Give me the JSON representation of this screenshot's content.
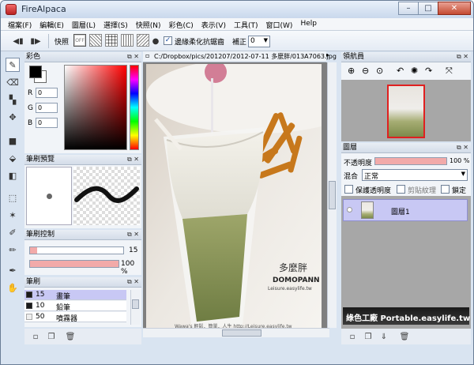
{
  "window": {
    "title": "FireAlpaca",
    "minimize_glyph": "–",
    "maximize_glyph": "□",
    "close_glyph": "✕"
  },
  "menu": [
    "檔案(F)",
    "編輯(E)",
    "圖層(L)",
    "選擇(S)",
    "快照(N)",
    "彩色(C)",
    "表示(V)",
    "工具(T)",
    "窗口(W)",
    "Help"
  ],
  "toolbar": {
    "snap_label": "快照",
    "snap_off_label": "OFF",
    "antialias_label": "邊緣柔化抗鋸齒",
    "antialias_checked": true,
    "correction_label": "補正",
    "correction_value": "0"
  },
  "color_panel": {
    "title": "彩色",
    "r_label": "R",
    "g_label": "G",
    "b_label": "B",
    "r_value": "0",
    "g_value": "0",
    "b_value": "0",
    "foreground": "#000000",
    "background": "#ffffff"
  },
  "brush_preview": {
    "title": "筆刷預覽"
  },
  "brush_control": {
    "title": "筆刷控制",
    "size_value": "15",
    "opacity_value": "100 %",
    "size_fraction": 0.08,
    "opacity_fraction": 1.0
  },
  "brush_list": {
    "title": "筆刷",
    "items": [
      {
        "size": "15",
        "name": "畫筆",
        "selected": true
      },
      {
        "size": "10",
        "name": "鉛筆",
        "selected": false
      },
      {
        "size": "50",
        "name": "噴霧器",
        "selected": false
      }
    ]
  },
  "canvas": {
    "tab_title": "C:/Dropbox/pics/201207/2012-07-11 多麼胖/013A7063.jpg",
    "logo_cn": "多麼胖",
    "logo_en": "DOMOPANN",
    "logo_url": "Leisure.easylife.tw",
    "caption": "Wawa's 輕鬆．簡單．人生   http://Leisure.easylife.tw"
  },
  "navigator": {
    "title": "領航員"
  },
  "layers": {
    "title": "圖層",
    "opacity_label": "不透明度",
    "opacity_value": "100 %",
    "opacity_fraction": 1.0,
    "blend_label": "混合",
    "blend_value": "正常",
    "protect_label": "保護透明度",
    "clip_label": "剪貼紋理",
    "lock_label": "鎖定",
    "layer_name": "圖層1"
  },
  "watermark": "綠色工廠 Portable.easylife.tw",
  "colors": {
    "accent_fill": "#f2aaa9",
    "selection": "#c8c8f4",
    "navigator_frame": "#e02020"
  }
}
